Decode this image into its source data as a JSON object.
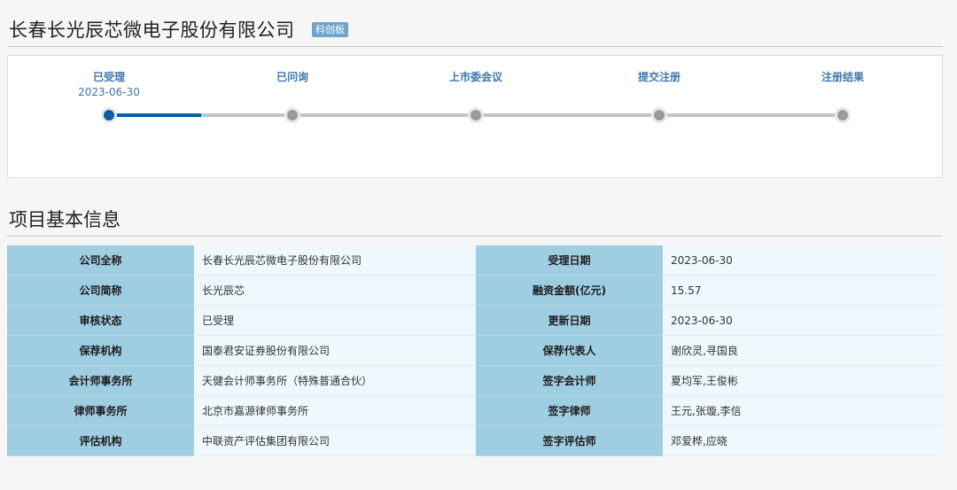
{
  "header": {
    "company_name": "长春长光辰芯微电子股份有限公司",
    "board_badge": "科创板"
  },
  "progress": {
    "steps": [
      {
        "label": "已受理",
        "date": "2023-06-30",
        "status": "done"
      },
      {
        "label": "已问询",
        "date": "",
        "status": "pending"
      },
      {
        "label": "上市委会议",
        "date": "",
        "status": "pending"
      },
      {
        "label": "提交注册",
        "date": "",
        "status": "pending"
      },
      {
        "label": "注册结果",
        "date": "",
        "status": "pending"
      }
    ]
  },
  "section": {
    "title": "项目基本信息"
  },
  "info": {
    "rows": [
      {
        "l1": "公司全称",
        "v1": "长春长光辰芯微电子股份有限公司",
        "l2": "受理日期",
        "v2": "2023-06-30"
      },
      {
        "l1": "公司简称",
        "v1": "长光辰芯",
        "l2": "融资金额(亿元)",
        "v2": "15.57"
      },
      {
        "l1": "审核状态",
        "v1": "已受理",
        "l2": "更新日期",
        "v2": "2023-06-30"
      },
      {
        "l1": "保荐机构",
        "v1": "国泰君安证券股份有限公司",
        "l2": "保荐代表人",
        "v2": "谢欣灵,寻国良"
      },
      {
        "l1": "会计师事务所",
        "v1": "天健会计师事务所（特殊普通合伙）",
        "l2": "签字会计师",
        "v2": "夏均军,王俊彬"
      },
      {
        "l1": "律师事务所",
        "v1": "北京市嘉源律师事务所",
        "l2": "签字律师",
        "v2": "王元,张璇,李信"
      },
      {
        "l1": "评估机构",
        "v1": "中联资产评估集团有限公司",
        "l2": "签字评估师",
        "v2": "邓爱桦,应晓"
      }
    ]
  },
  "colors": {
    "accent": "#0b5ea5",
    "step_text": "#4077ad",
    "label_cell": "#9fcde1",
    "value_cell": "#eef8fd",
    "badge": "#6fa5c9"
  }
}
